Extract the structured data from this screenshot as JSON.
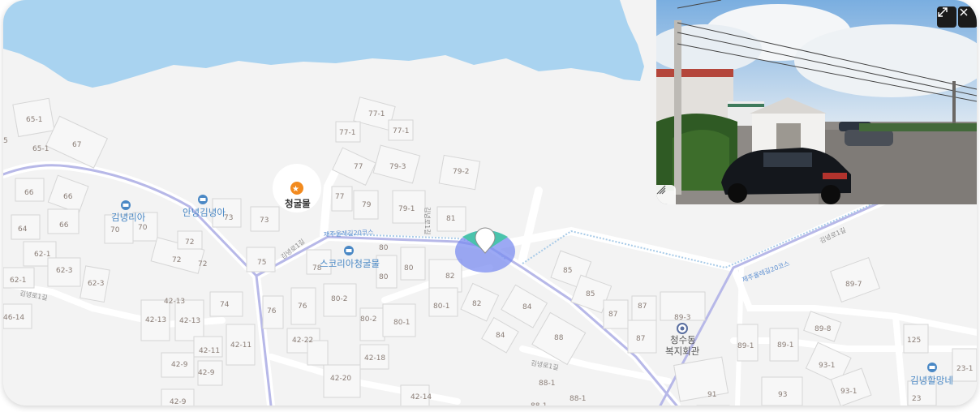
{
  "map": {
    "pois": {
      "cheonggulmul": "청굴물",
      "annyeong_gimnyeonga": "안녕김녕아",
      "gimnyeongria": "김녕리아",
      "scorea_cheonggulmul": "스코리아청굴물",
      "cheongsu_welfare_line1": "청수동",
      "cheongsu_welfare_line2": "복지회관",
      "gimnyeong_halmangne": "김녕할망네"
    },
    "roads": {
      "gimnyeong_ro1": "김녕로1길",
      "gimnyeong_ro1_b": "김녕로1길",
      "gimnyeong_ro1_c": "김녕로1길",
      "gimnyeong_ro1_d": "김녕로1길",
      "gimnyeong_ro1_e": "김녕로1길",
      "trail_west": "제주올레길20코스",
      "trail_east": "제주올레길20코스"
    },
    "lots": [
      "65-1",
      "65-1",
      "67",
      "5",
      "66",
      "66",
      "66",
      "64",
      "62-1",
      "62-3",
      "62-3",
      "62-1",
      "46-14",
      "70",
      "70",
      "72",
      "72",
      "72",
      "73",
      "73",
      "75",
      "74",
      "76",
      "76",
      "77-1",
      "77-1",
      "77-1",
      "77",
      "77",
      "79-3",
      "79-2",
      "79",
      "79-1",
      "81",
      "78",
      "80",
      "80",
      "80",
      "82",
      "80-2",
      "80-2",
      "80-1",
      "80-1",
      "82",
      "84",
      "84",
      "42-13",
      "42-13",
      "42-13",
      "42-11",
      "42-11",
      "42-9",
      "42-9",
      "42-9",
      "42-22",
      "42-18",
      "42-20",
      "42-14",
      "85",
      "85",
      "87",
      "87",
      "87",
      "88",
      "88-1",
      "88-1",
      "88-1",
      "89-3",
      "89-1",
      "89-1",
      "89-8",
      "89-7",
      "93-1",
      "93-1",
      "93",
      "91",
      "125",
      "23-1",
      "23"
    ]
  },
  "street_view": {
    "expand_icon": "expand-icon",
    "close_icon": "close-icon",
    "menu_icon": "menu-icon"
  },
  "colors": {
    "sea": "#a9d3f0",
    "land": "#f3f3f3",
    "road_main": "#b7b8e8",
    "trail": "#a8cbe8",
    "poi_blue": "#4a88c5",
    "poi_orange": "#f28a1e",
    "location_disc": "#7b8cf0",
    "location_heading": "#3cc8a0"
  }
}
